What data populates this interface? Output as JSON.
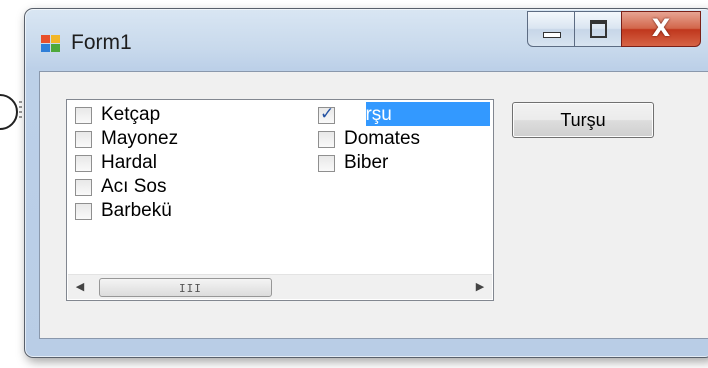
{
  "window": {
    "title": "Form1",
    "close_glyph": "X"
  },
  "checkedlistbox": {
    "items": [
      {
        "label": "Ketçap",
        "checked": false
      },
      {
        "label": "Mayonez",
        "checked": false
      },
      {
        "label": "Hardal",
        "checked": false
      },
      {
        "label": "Acı Sos",
        "checked": false
      },
      {
        "label": "Barbekü",
        "checked": false
      },
      {
        "label": "Turşu",
        "checked": true,
        "selected": true
      },
      {
        "label": "Domates",
        "checked": false
      },
      {
        "label": "Biber",
        "checked": false
      }
    ],
    "scroll_grip": "III"
  },
  "button": {
    "label": "Turşu"
  },
  "colors": {
    "selection": "#3399ff",
    "close_button": "#c0371d",
    "client_bg": "#f0f0f0"
  },
  "icons": [
    "app-form-icon",
    "minimize-icon",
    "maximize-icon",
    "close-icon",
    "scroll-left-arrow-icon",
    "scroll-right-arrow-icon"
  ]
}
